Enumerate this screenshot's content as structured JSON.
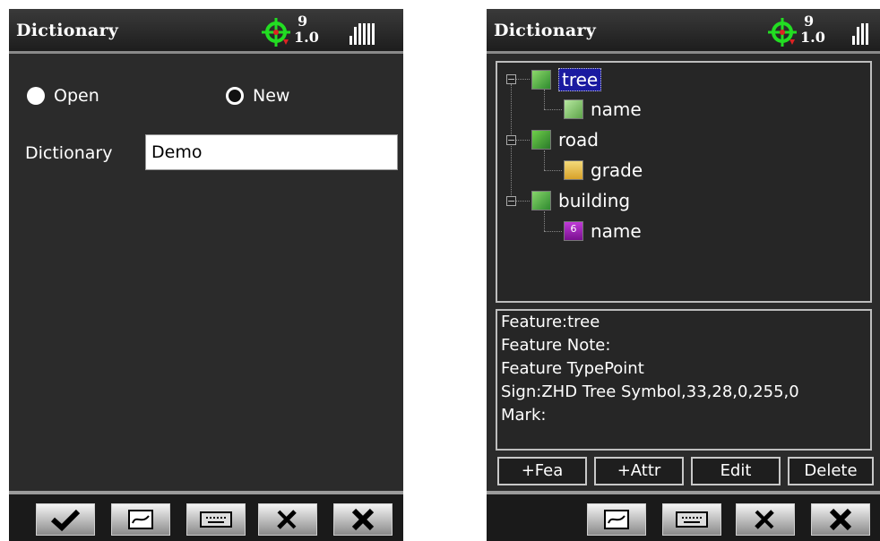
{
  "screens": {
    "left": {
      "title": "Dictionary",
      "status": {
        "satellites": "9",
        "pdop": "1.0",
        "crosshair_icon": "gps-crosshair-icon",
        "signal_icon": "signal-bars-icon"
      },
      "radio_open": {
        "label": "Open",
        "selected": true
      },
      "radio_new": {
        "label": "New",
        "selected": false
      },
      "dictionary_label": "Dictionary",
      "dictionary_value": "Demo",
      "toolbar": [
        "check-icon",
        "map-icon",
        "keyboard-icon",
        "tools-icon",
        "close-icon"
      ]
    },
    "right": {
      "title": "Dictionary",
      "status": {
        "satellites": "9",
        "pdop": "1.0"
      },
      "tree": {
        "nodes": [
          {
            "label": "tree",
            "icon": "point-feature-icon",
            "selected": true
          },
          {
            "label": "name",
            "icon": "text-attr-icon"
          },
          {
            "label": "road",
            "icon": "line-feature-icon"
          },
          {
            "label": "grade",
            "icon": "list-attr-icon"
          },
          {
            "label": "building",
            "icon": "polygon-feature-icon"
          },
          {
            "label": "name",
            "icon": "number-attr-icon",
            "badge": "6"
          }
        ]
      },
      "info": {
        "feature": "Feature:tree",
        "note": "Feature Note:",
        "type": "Feature TypePoint",
        "sign": "Sign:ZHD Tree Symbol,33,28,0,255,0",
        "mark": "Mark:"
      },
      "actions": {
        "add_feature": "+Fea",
        "add_attr": "+Attr",
        "edit": "Edit",
        "delete": "Delete"
      },
      "toolbar": [
        "map-icon",
        "keyboard-icon",
        "tools-icon",
        "close-icon"
      ]
    }
  },
  "colors": {
    "background": "#2b2b2b",
    "gps_green": "#22dd22",
    "gps_red": "#dd2222",
    "selection_blue": "#1a1aa0"
  }
}
